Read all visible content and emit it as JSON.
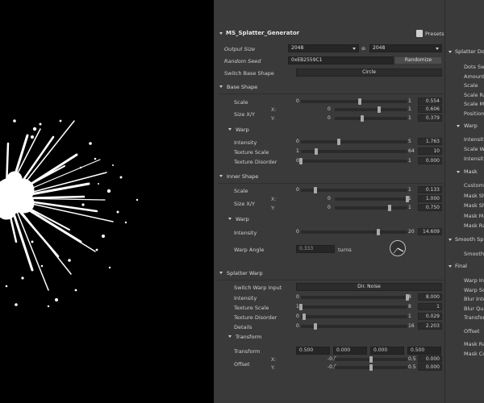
{
  "generator": {
    "title": "MS_Splatter_Generator",
    "presets_label": "Presets",
    "output_size": {
      "label": "Output Size",
      "width": "2048",
      "height": "2048"
    },
    "random_seed": {
      "label": "Random Seed",
      "value": "0xEB2559C1",
      "button": "Randomize"
    },
    "switch_base_shape": {
      "label": "Switch Base Shape",
      "value": "Circle"
    },
    "base_shape": {
      "title": "Base Shape",
      "scale": {
        "label": "Scale",
        "min": "0",
        "max": "1",
        "value": "0.554",
        "frac": 0.554
      },
      "size_xy": {
        "label": "Size X/Y",
        "x": {
          "axis": "X:",
          "min": "0",
          "max": "1",
          "value": "0.606",
          "frac": 0.606
        },
        "y": {
          "axis": "Y:",
          "min": "0",
          "max": "1",
          "value": "0.379",
          "frac": 0.379
        }
      },
      "warp": {
        "title": "Warp",
        "intensity": {
          "label": "Intensity",
          "min": "0",
          "max": "5",
          "value": "1.763",
          "frac": 0.3526
        },
        "texture_scale": {
          "label": "Texture Scale",
          "min": "1",
          "max": "64",
          "value": "10",
          "frac": 0.143
        },
        "texture_disorder": {
          "label": "Texture Disorder",
          "min": "0",
          "max": "1",
          "value": "0.000",
          "frac": 0.0
        }
      }
    },
    "inner_shape": {
      "title": "Inner Shape",
      "scale": {
        "label": "Scale",
        "min": "0",
        "max": "1",
        "value": "0.133",
        "frac": 0.133
      },
      "size_xy": {
        "label": "Size X/Y",
        "x": {
          "axis": "X:",
          "min": "0",
          "max": "1",
          "value": "1.000",
          "frac": 1.0
        },
        "y": {
          "axis": "Y:",
          "min": "0",
          "max": "1",
          "value": "0.750",
          "frac": 0.75
        }
      },
      "warp": {
        "title": "Warp",
        "intensity": {
          "label": "Intensity",
          "min": "0",
          "max": "20",
          "value": "14.609",
          "frac": 0.73
        },
        "warp_angle": {
          "label": "Warp Angle",
          "value": "0.333",
          "unit": "turns",
          "turns": 0.333
        }
      }
    },
    "splatter_warp": {
      "title": "Splatter Warp",
      "switch_input": {
        "label": "Switch Warp Input",
        "value": "Dir. Noise"
      },
      "intensity": {
        "label": "Intensity",
        "min": "0",
        "max": "8",
        "value": "8.000",
        "frac": 1.0
      },
      "texture_scale": {
        "label": "Texture Scale",
        "min": "1",
        "max": "8",
        "value": "1",
        "frac": 0.0
      },
      "texture_disorder": {
        "label": "Texture Disorder",
        "min": "0",
        "max": "1",
        "value": "0.029",
        "frac": 0.029
      },
      "details": {
        "label": "Details",
        "min": "0",
        "max": "16",
        "value": "2.203",
        "frac": 0.138
      },
      "transform": {
        "title": "Transform",
        "transform": {
          "label": "Transform",
          "values": [
            "0.500",
            "0.000",
            "0.000",
            "0.500"
          ]
        },
        "offset": {
          "label": "Offset",
          "x": {
            "axis": "X:",
            "min": "-0.5",
            "max": "0.5",
            "value": "0.000",
            "frac": 0.5
          },
          "y": {
            "axis": "Y:",
            "min": "-0.5",
            "max": "0.5",
            "value": "0.000",
            "frac": 0.5
          }
        }
      }
    }
  },
  "side_panel": {
    "splatter_dots_title": "Splatter Do",
    "items_a": [
      "Dots Switc",
      "Amount",
      "Scale",
      "Scale Ran",
      "Scale Mar",
      "Position R"
    ],
    "warp_title": "Warp",
    "items_b": [
      "Intensity",
      "Scale War",
      "Intensity"
    ],
    "mask_title": "Mask",
    "items_c": [
      "Custom M",
      "Mask Sha",
      "Mask Sha",
      "Mask Mar",
      "Mask Ran"
    ],
    "smooth_title": "Smooth Spl",
    "smooth_item": "Smooth",
    "final_title": "Final",
    "items_d": [
      "Warp Int",
      "Warp Sca",
      "Blur Inter",
      "Blur Qual",
      "Transform"
    ],
    "offset_item": "Offset",
    "items_e": [
      "Mask Ran",
      "Mask Cov"
    ]
  }
}
